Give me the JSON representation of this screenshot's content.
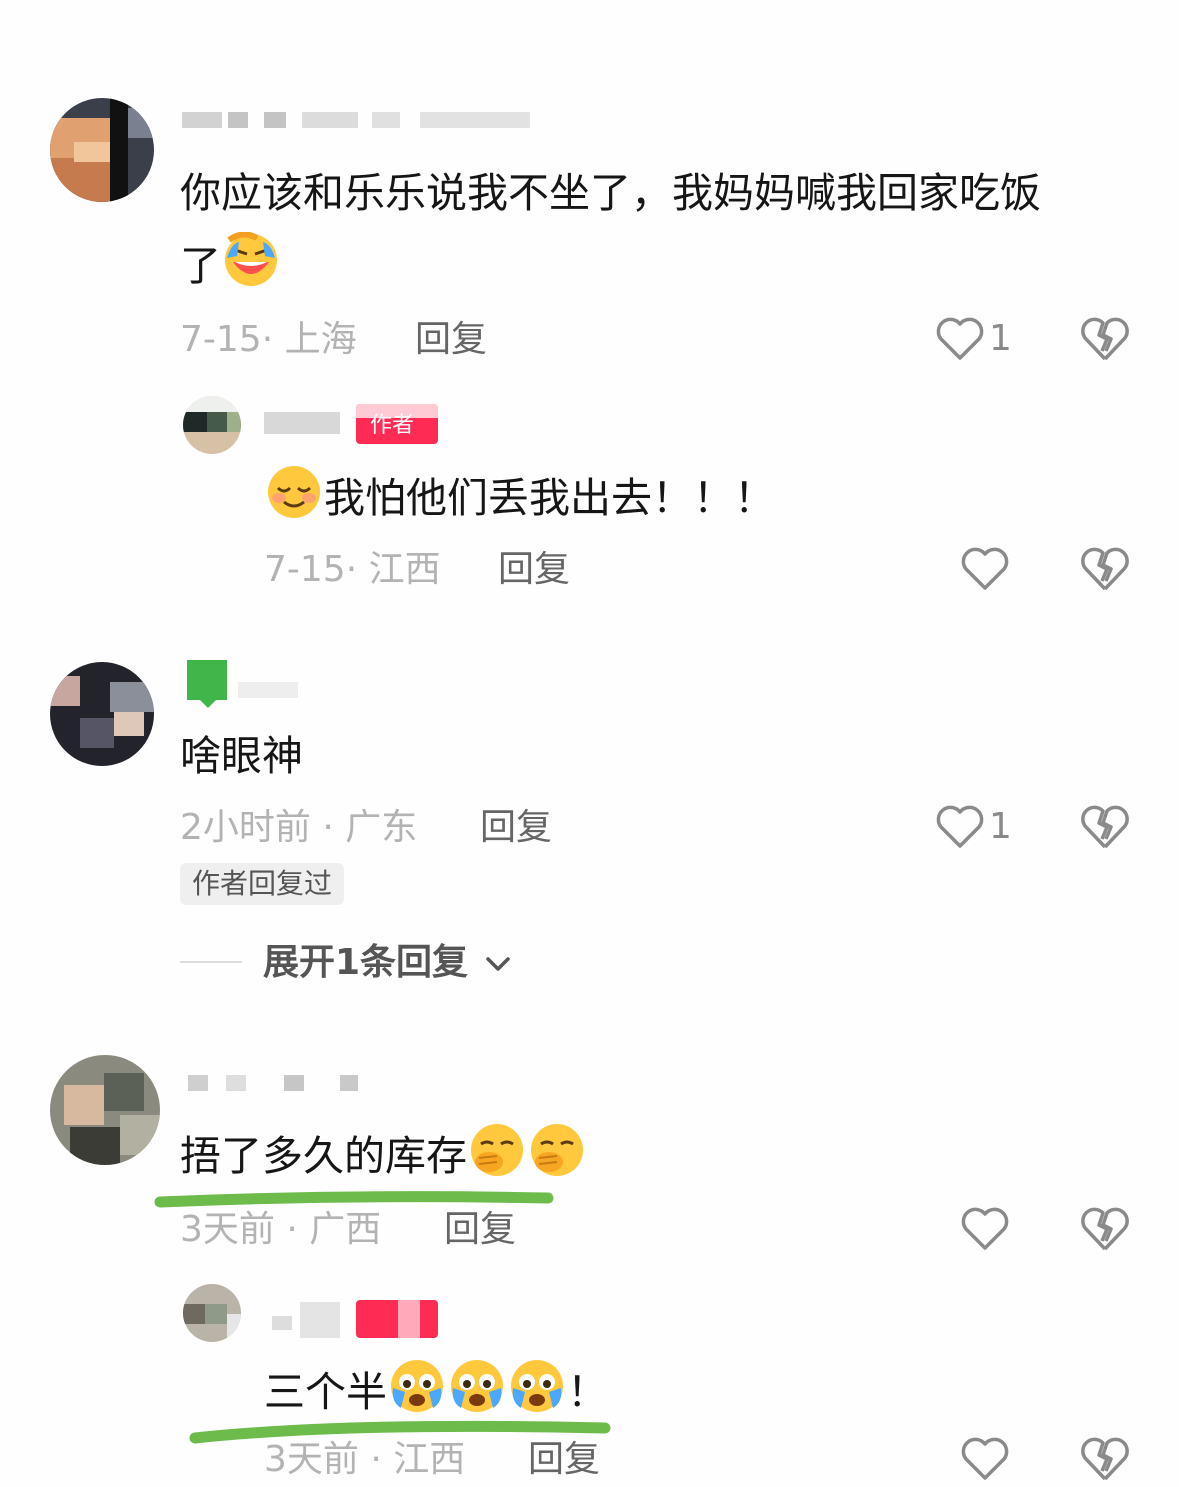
{
  "comments": [
    {
      "text_line1": "你应该和乐乐说我不坐了，我妈妈喊我回家吃饭",
      "text_line2": "了",
      "emoji": "rofl-emoji",
      "date": "7-15",
      "location": "上海",
      "reply_label": "回复",
      "like_count": "1",
      "reply": {
        "text": "我怕他们丢我出去！！！",
        "emoji_before": "smiling-eyes-emoji",
        "date": "7-15",
        "location": "江西",
        "reply_label": "回复",
        "author_tag": "作者"
      }
    },
    {
      "text": "啥眼神",
      "time": "2小时前",
      "location": "广东",
      "reply_label": "回复",
      "like_count": "1",
      "author_replied_tag": "作者回复过",
      "expand_label": "展开1条回复"
    },
    {
      "text": "捂了多久的库存",
      "emojis": [
        "hand-over-mouth-emoji",
        "hand-over-mouth-emoji"
      ],
      "time": "3天前",
      "location": "广西",
      "reply_label": "回复",
      "reply": {
        "text": "三个半",
        "emojis": [
          "crying-joy-emoji",
          "crying-joy-emoji",
          "crying-joy-emoji"
        ],
        "suffix": "！",
        "time": "3天前",
        "location": "江西",
        "reply_label": "回复"
      }
    }
  ],
  "colors": {
    "author_tag": "#fe2c55",
    "annotation_underline": "#6dbb4a",
    "meta_gray": "#b3b3b3"
  }
}
